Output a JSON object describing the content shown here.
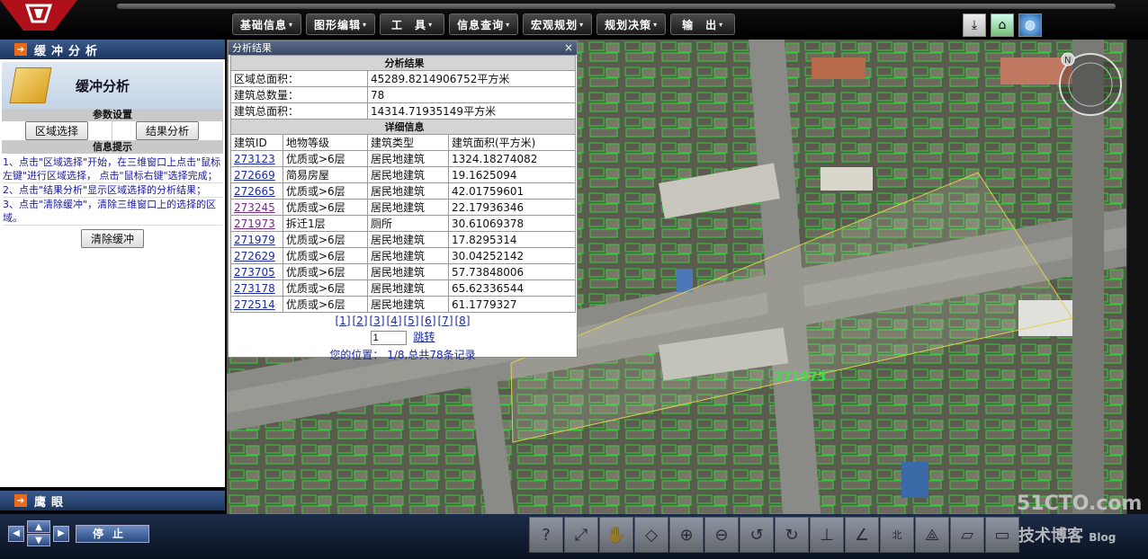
{
  "menu": [
    {
      "label": "基础信息"
    },
    {
      "label": "图形编辑"
    },
    {
      "label": "工　具"
    },
    {
      "label": "信息查询"
    },
    {
      "label": "宏观规划"
    },
    {
      "label": "规划决策"
    },
    {
      "label": "输　出"
    }
  ],
  "top_icons": [
    "download-icon",
    "house-icon",
    "globe-icon"
  ],
  "left_panel": {
    "header": "缓冲分析",
    "title": "缓冲分析",
    "param_section": "参数设置",
    "region_select_btn": "区域选择",
    "result_analysis_btn": "结果分析",
    "tips_section": "信息提示",
    "tips": [
      "1、点击\"区域选择\"开始，在三维窗口上点击\"鼠标左键\"进行区域选择， 点击\"鼠标右键\"选择完成；",
      "2、点击\"结果分析\"显示区域选择的分析结果；",
      "3、点击\"清除缓冲\"，清除三维窗口上的选择的区域。"
    ],
    "clear_btn": "清除缓冲"
  },
  "eagle_eye_header": "鹰眼",
  "dialog": {
    "title": "分析结果",
    "summary_header": "分析结果",
    "summary": [
      {
        "label": "区域总面积：",
        "value": "45289.8214906752平方米"
      },
      {
        "label": "建筑总数量：",
        "value": "78"
      },
      {
        "label": "建筑总面积：",
        "value": "14314.71935149平方米"
      }
    ],
    "detail_header": "详细信息",
    "columns": [
      "建筑ID",
      "地物等级",
      "建筑类型",
      "建筑面积(平方米)"
    ],
    "rows": [
      {
        "id": "273123",
        "grade": "优质或>6层",
        "type": "居民地建筑",
        "area": "1324.18274082"
      },
      {
        "id": "272669",
        "grade": "简易房屋",
        "type": "居民地建筑",
        "area": "19.1625094"
      },
      {
        "id": "272665",
        "grade": "优质或>6层",
        "type": "居民地建筑",
        "area": "42.01759601"
      },
      {
        "id": "273245",
        "grade": "优质或>6层",
        "type": "居民地建筑",
        "area": "22.17936346"
      },
      {
        "id": "271973",
        "grade": "拆迁1层",
        "type": "厕所",
        "area": "30.61069378"
      },
      {
        "id": "271979",
        "grade": "优质或>6层",
        "type": "居民地建筑",
        "area": "17.8295314"
      },
      {
        "id": "272629",
        "grade": "优质或>6层",
        "type": "居民地建筑",
        "area": "30.04252142"
      },
      {
        "id": "273705",
        "grade": "优质或>6层",
        "type": "居民地建筑",
        "area": "57.73848006"
      },
      {
        "id": "273178",
        "grade": "优质或>6层",
        "type": "居民地建筑",
        "area": "65.62336544"
      },
      {
        "id": "272514",
        "grade": "优质或>6层",
        "type": "居民地建筑",
        "area": "61.1779327"
      }
    ],
    "pages": [
      "[1]",
      "[2]",
      "[3]",
      "[4]",
      "[5]",
      "[6]",
      "[7]",
      "[8]"
    ],
    "jump_value": "1",
    "jump_label": "跳转",
    "position_text": "您的位置： 1/8,总共78条记录"
  },
  "map": {
    "building_label": "271973",
    "compass_label": "N"
  },
  "bottom": {
    "stop_label": "停止",
    "tools": [
      "query-icon",
      "measure-icon",
      "pan-icon",
      "rotate-icon",
      "zoom-in-icon",
      "zoom-out-icon",
      "rotate-left-icon",
      "rotate-right-icon",
      "height-icon",
      "angle-icon",
      "north-icon",
      "tilt-icon",
      "ruler-icon"
    ],
    "north_label": "北"
  },
  "watermark": {
    "line1": "51CTO.com",
    "line2": "技术博客",
    "line3": "Blog"
  }
}
